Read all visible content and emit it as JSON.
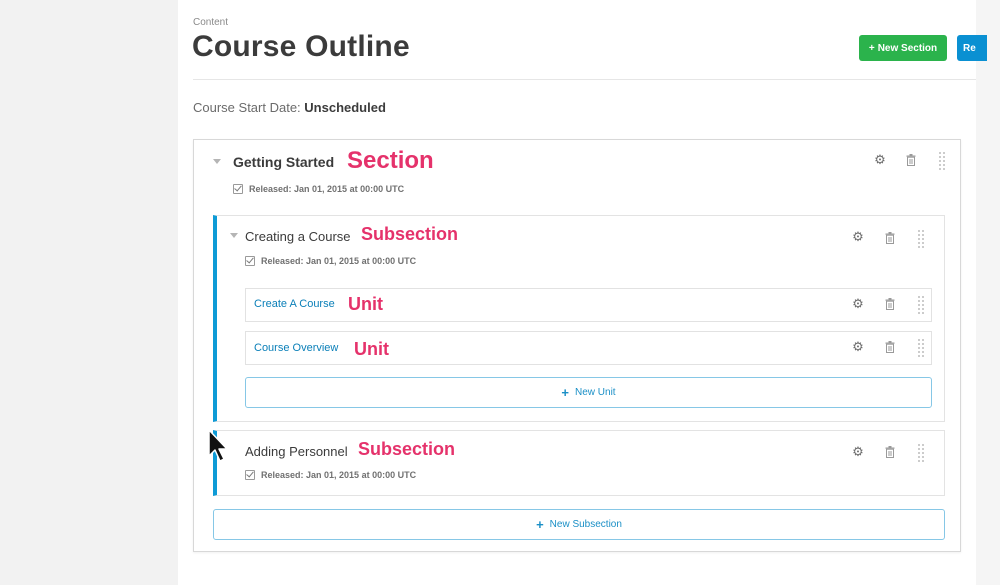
{
  "header": {
    "eyebrow": "Content",
    "title": "Course Outline",
    "new_section_label": "New Section",
    "reindex_label": "Re",
    "start_date_label": "Course Start Date:",
    "start_date_value": "Unscheduled"
  },
  "section": {
    "name": "Getting Started",
    "release": "Released: Jan 01, 2015 at 00:00 UTC",
    "tag": "Section"
  },
  "subsections": [
    {
      "name": "Creating a Course",
      "release": "Released: Jan 01, 2015 at 00:00 UTC",
      "tag": "Subsection",
      "units": [
        {
          "name": "Create A Course",
          "tag": "Unit"
        },
        {
          "name": "Course Overview",
          "tag": "Unit"
        }
      ],
      "new_unit_label": "New Unit"
    },
    {
      "name": "Adding Personnel",
      "release": "Released: Jan 01, 2015 at 00:00 UTC",
      "tag": "Subsection"
    }
  ],
  "new_subsection_label": "New Subsection",
  "icons": {
    "gear": "gear-icon",
    "trash": "trash-icon",
    "drag": "drag-handle-icon",
    "expand": "chevron-down-icon",
    "check": "checkbox-icon",
    "cursor": "mouse-pointer-icon"
  },
  "colors": {
    "accent": "#0e9bd6",
    "new_section_bg": "#2bb34c",
    "annotation": "#e5326b",
    "link": "#0a7fb8"
  }
}
